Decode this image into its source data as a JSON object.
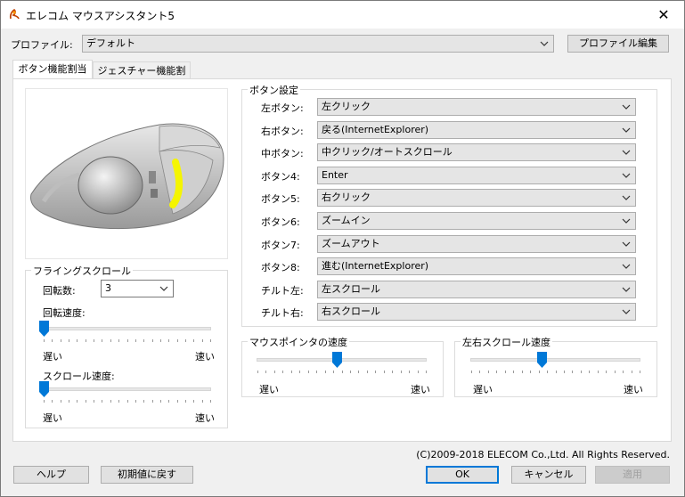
{
  "window": {
    "title": "エレコム マウスアシスタント5",
    "close_glyph": "✕"
  },
  "profile": {
    "label": "プロファイル:",
    "value": "デフォルト",
    "edit_button": "プロファイル編集"
  },
  "tabs": [
    {
      "label": "ボタン機能割当",
      "active": true
    },
    {
      "label": "ジェスチャー機能割当",
      "active": false
    }
  ],
  "flying_scroll": {
    "group_label": "フライングスクロール",
    "count_label": "回転数:",
    "count_value": "3",
    "speed_label": "回転速度:",
    "speed_slow": "遅い",
    "speed_fast": "速い",
    "speed_level": 0,
    "scroll_speed_label": "スクロール速度:",
    "scroll_slow": "遅い",
    "scroll_fast": "速い",
    "scroll_level": 0
  },
  "button_settings": {
    "group_label": "ボタン設定",
    "rows": [
      {
        "label": "左ボタン:",
        "value": "左クリック"
      },
      {
        "label": "右ボタン:",
        "value": "戻る(InternetExplorer)"
      },
      {
        "label": "中ボタン:",
        "value": "中クリック/オートスクロール"
      },
      {
        "label": "ボタン4:",
        "value": "Enter"
      },
      {
        "label": "ボタン5:",
        "value": "右クリック"
      },
      {
        "label": "ボタン6:",
        "value": "ズームイン"
      },
      {
        "label": "ボタン7:",
        "value": "ズームアウト"
      },
      {
        "label": "ボタン8:",
        "value": "進む(InternetExplorer)"
      },
      {
        "label": "チルト左:",
        "value": "左スクロール"
      },
      {
        "label": "チルト右:",
        "value": "右スクロール"
      }
    ]
  },
  "pointer_speed": {
    "group_label": "マウスポインタの速度",
    "slow": "遅い",
    "fast": "速い",
    "level": 0.5
  },
  "hscroll_speed": {
    "group_label": "左右スクロール速度",
    "slow": "遅い",
    "fast": "速い",
    "level": 0.5
  },
  "copyright": "(C)2009-2018 ELECOM Co.,Ltd. All Rights Reserved.",
  "footer": {
    "help": "ヘルプ",
    "reset": "初期値に戻す",
    "ok": "OK",
    "cancel": "キャンセル",
    "apply": "適用"
  },
  "colors": {
    "accent": "#0078d7",
    "highlight": "#f5f500"
  }
}
